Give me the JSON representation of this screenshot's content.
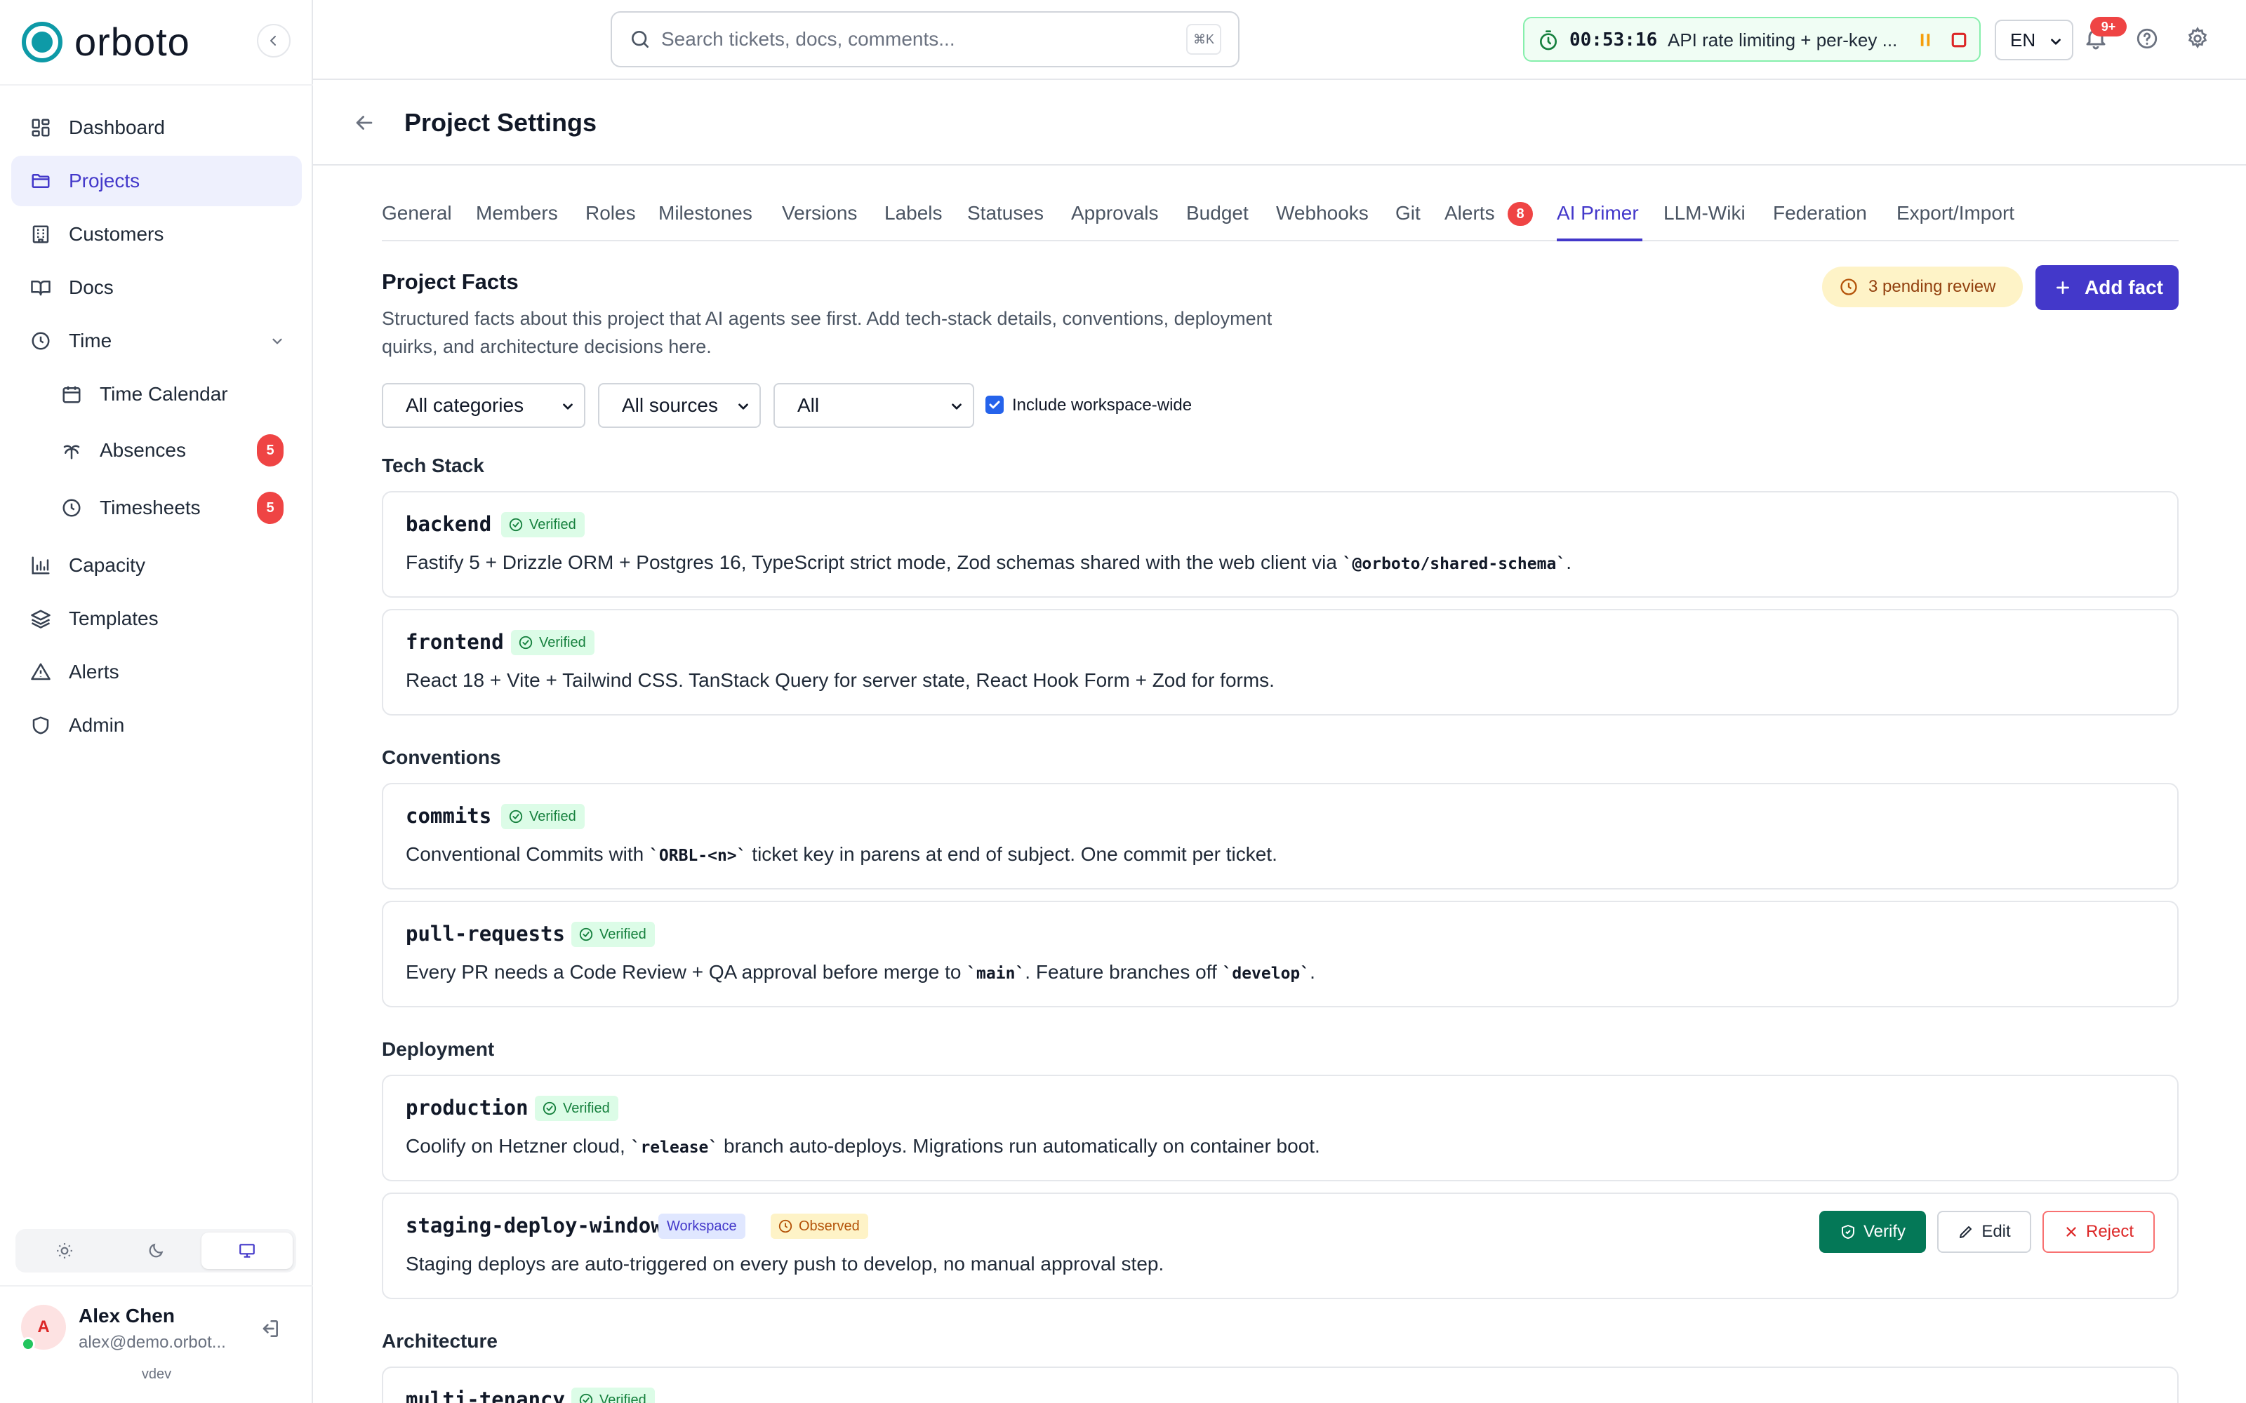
{
  "app": {
    "name": "orboto",
    "version": "vdev"
  },
  "sidebar": {
    "items": [
      {
        "label": "Dashboard",
        "icon": "dashboard-icon"
      },
      {
        "label": "Projects",
        "icon": "folder-icon",
        "active": true
      },
      {
        "label": "Customers",
        "icon": "building-icon"
      },
      {
        "label": "Docs",
        "icon": "book-icon"
      },
      {
        "label": "Time",
        "icon": "clock-icon",
        "expanded": true
      },
      {
        "label": "Time Calendar",
        "icon": "calendar-icon"
      },
      {
        "label": "Absences",
        "icon": "palm-tree-icon",
        "badge": "5"
      },
      {
        "label": "Timesheets",
        "icon": "clock-icon",
        "badge": "5"
      },
      {
        "label": "Capacity",
        "icon": "bar-chart-icon"
      },
      {
        "label": "Templates",
        "icon": "layers-icon"
      },
      {
        "label": "Alerts",
        "icon": "alert-triangle-icon"
      },
      {
        "label": "Admin",
        "icon": "shield-icon"
      }
    ],
    "theme_options": [
      "light",
      "dark",
      "system"
    ],
    "theme_selected": "system",
    "user": {
      "initial": "A",
      "name": "Alex Chen",
      "email": "alex@demo.orbot..."
    }
  },
  "topbar": {
    "search_placeholder": "Search tickets, docs, comments...",
    "search_shortcut": "⌘K",
    "timer": {
      "time": "00:53:16",
      "label": "API rate limiting + per-key ..."
    },
    "language": "EN",
    "notifications_badge": "9+"
  },
  "page": {
    "title": "Project Settings"
  },
  "tabs": [
    {
      "label": "General"
    },
    {
      "label": "Members"
    },
    {
      "label": "Roles"
    },
    {
      "label": "Milestones"
    },
    {
      "label": "Versions"
    },
    {
      "label": "Labels"
    },
    {
      "label": "Statuses"
    },
    {
      "label": "Approvals"
    },
    {
      "label": "Budget"
    },
    {
      "label": "Webhooks"
    },
    {
      "label": "Git"
    },
    {
      "label": "Alerts",
      "badge": "8"
    },
    {
      "label": "AI Primer",
      "active": true
    },
    {
      "label": "LLM-Wiki"
    },
    {
      "label": "Federation"
    },
    {
      "label": "Export/Import"
    }
  ],
  "facts": {
    "title": "Project Facts",
    "description": "Structured facts about this project that AI agents see first. Add tech-stack details, conventions, deployment quirks, and architecture decisions here.",
    "pending_label": "3 pending review",
    "add_label": "Add fact",
    "filters": {
      "category": "All categories",
      "source": "All sources",
      "status": "All",
      "workspace_label": "Include workspace-wide",
      "workspace_checked": true
    },
    "groups": [
      {
        "title": "Tech Stack",
        "items": [
          {
            "key": "backend",
            "badges": [
              "Verified"
            ],
            "text": [
              "Fastify 5 + Drizzle ORM + Postgres 16, TypeScript strict mode, Zod schemas shared with the web client via ",
              "`@orboto/shared-schema`",
              "."
            ]
          },
          {
            "key": "frontend",
            "badges": [
              "Verified"
            ],
            "text": [
              "React 18 + Vite + Tailwind CSS. TanStack Query for server state, React Hook Form + Zod for forms."
            ]
          }
        ]
      },
      {
        "title": "Conventions",
        "items": [
          {
            "key": "commits",
            "badges": [
              "Verified"
            ],
            "text": [
              "Conventional Commits with ",
              "`ORBL-<n>`",
              " ticket key in parens at end of subject. One commit per ticket."
            ]
          },
          {
            "key": "pull-requests",
            "badges": [
              "Verified"
            ],
            "text": [
              "Every PR needs a Code Review + QA approval before merge to ",
              "`main`",
              ". Feature branches off ",
              "`develop`",
              "."
            ]
          }
        ]
      },
      {
        "title": "Deployment",
        "items": [
          {
            "key": "production",
            "badges": [
              "Verified"
            ],
            "text": [
              "Coolify on Hetzner cloud, ",
              "`release`",
              " branch auto-deploys. Migrations run automatically on container boot."
            ]
          },
          {
            "key": "staging-deploy-window",
            "badges": [
              "Workspace",
              "Observed"
            ],
            "text": [
              "Staging deploys are auto-triggered on every push to develop, no manual approval step."
            ],
            "actions": [
              "Verify",
              "Edit",
              "Reject"
            ]
          }
        ]
      },
      {
        "title": "Architecture",
        "items": [
          {
            "key": "multi-tenancy",
            "badges": [
              "Verified"
            ],
            "text": []
          }
        ]
      }
    ]
  },
  "colors": {
    "accent": "#4338ca",
    "brand": "#0e9aa7",
    "verified": "#15803d",
    "danger": "#ef4444"
  }
}
